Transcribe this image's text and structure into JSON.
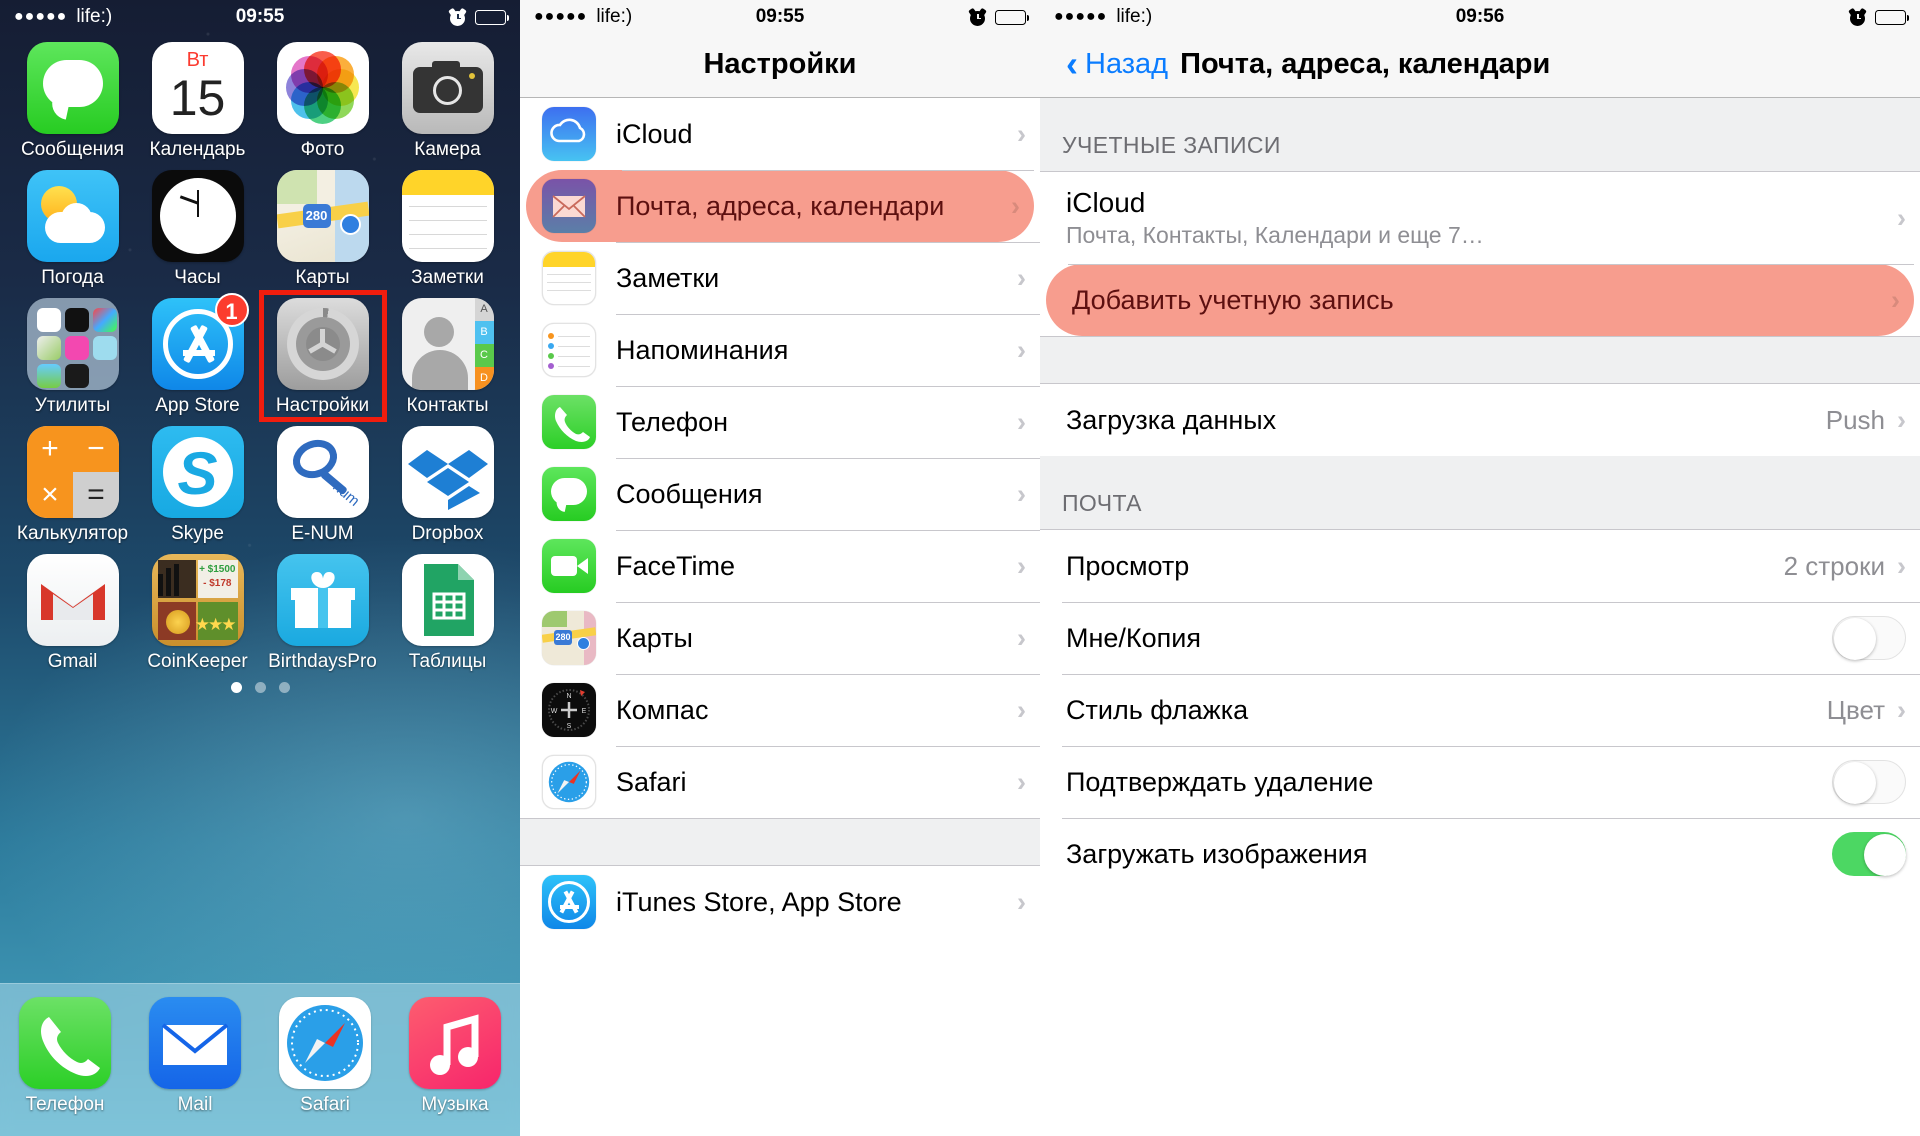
{
  "status_bar": {
    "signal_dots": "●●●●●",
    "carrier": "life:)",
    "time_home": "09:55",
    "time_settings": "09:55",
    "time_detail": "09:56",
    "alarm_icon": "alarm-clock-icon",
    "battery_icon": "battery-icon"
  },
  "home_screen": {
    "rows": [
      [
        {
          "label": "Сообщения",
          "icon": "messages-icon"
        },
        {
          "label": "Календарь",
          "icon": "calendar-icon",
          "weekday": "Вт",
          "day": "15"
        },
        {
          "label": "Фото",
          "icon": "photos-icon"
        },
        {
          "label": "Камера",
          "icon": "camera-icon"
        }
      ],
      [
        {
          "label": "Погода",
          "icon": "weather-icon"
        },
        {
          "label": "Часы",
          "icon": "clock-icon"
        },
        {
          "label": "Карты",
          "icon": "maps-icon",
          "route": "280"
        },
        {
          "label": "Заметки",
          "icon": "notes-icon"
        }
      ],
      [
        {
          "label": "Утилиты",
          "icon": "utilities-folder-icon"
        },
        {
          "label": "App Store",
          "icon": "app-store-icon",
          "badge": "1"
        },
        {
          "label": "Настройки",
          "icon": "settings-icon",
          "highlighted": true
        },
        {
          "label": "Контакты",
          "icon": "contacts-icon"
        }
      ],
      [
        {
          "label": "Калькулятор",
          "icon": "calculator-icon"
        },
        {
          "label": "Skype",
          "icon": "skype-icon"
        },
        {
          "label": "E-NUM",
          "icon": "enum-icon"
        },
        {
          "label": "Dropbox",
          "icon": "dropbox-icon"
        }
      ],
      [
        {
          "label": "Gmail",
          "icon": "gmail-icon"
        },
        {
          "label": "CoinKeeper",
          "icon": "coinkeeper-icon",
          "plus": "+ $1500",
          "minus": "- $178"
        },
        {
          "label": "BirthdaysPro",
          "icon": "birthdayspro-icon"
        },
        {
          "label": "Таблицы",
          "icon": "google-sheets-icon"
        }
      ]
    ],
    "page_dots": {
      "count": 3,
      "active_index": 0
    },
    "dock": [
      {
        "label": "Телефон",
        "icon": "phone-icon"
      },
      {
        "label": "Mail",
        "icon": "mail-icon"
      },
      {
        "label": "Safari",
        "icon": "safari-icon"
      },
      {
        "label": "Музыка",
        "icon": "music-icon"
      }
    ]
  },
  "settings_panel": {
    "title": "Настройки",
    "items": [
      {
        "label": "iCloud",
        "icon": "icloud-icon"
      },
      {
        "label": "Почта, адреса, календари",
        "icon": "mail-settings-icon",
        "highlighted": true
      },
      {
        "label": "Заметки",
        "icon": "notes-icon"
      },
      {
        "label": "Напоминания",
        "icon": "reminders-icon"
      },
      {
        "label": "Телефон",
        "icon": "phone-icon"
      },
      {
        "label": "Сообщения",
        "icon": "messages-icon"
      },
      {
        "label": "FaceTime",
        "icon": "facetime-icon"
      },
      {
        "label": "Карты",
        "icon": "maps-icon"
      },
      {
        "label": "Компас",
        "icon": "compass-icon"
      },
      {
        "label": "Safari",
        "icon": "safari-icon"
      }
    ],
    "items_after_gap": [
      {
        "label": "iTunes Store, App Store",
        "icon": "app-store-icon"
      }
    ],
    "chevron": "›"
  },
  "detail_panel": {
    "back_label": "Назад",
    "back_icon": "chevron-left-icon",
    "title": "Почта, адреса, календари",
    "accounts_header": "УЧЕТНЫЕ ЗАПИСИ",
    "accounts": [
      {
        "label": "iCloud",
        "sub": "Почта, Контакты, Календари и еще 7…",
        "type": "link"
      },
      {
        "label": "Добавить учетную запись",
        "type": "link",
        "highlighted": true
      }
    ],
    "fetch_row": {
      "label": "Загрузка данных",
      "value": "Push",
      "type": "link"
    },
    "mail_header": "ПОЧТА",
    "mail_rows": [
      {
        "label": "Просмотр",
        "value": "2 строки",
        "type": "link"
      },
      {
        "label": "Мне/Копия",
        "type": "switch",
        "on": false
      },
      {
        "label": "Стиль флажка",
        "value": "Цвет",
        "type": "link"
      },
      {
        "label": "Подтверждать удаление",
        "type": "switch",
        "on": false
      },
      {
        "label": "Загружать изображения",
        "type": "switch",
        "on": true
      }
    ],
    "chevron": "›"
  },
  "colors": {
    "accent_blue": "#0a7cff",
    "highlight_salmon": "#f79d8e",
    "highlight_text": "#5d1010",
    "switch_on_green": "#4cd763",
    "badge_red": "#fc3c2e",
    "selection_box_red": "#f01d0e",
    "group_bg": "#eff0f1",
    "separator": "#c8c7cc",
    "value_gray": "#8e8e93"
  }
}
